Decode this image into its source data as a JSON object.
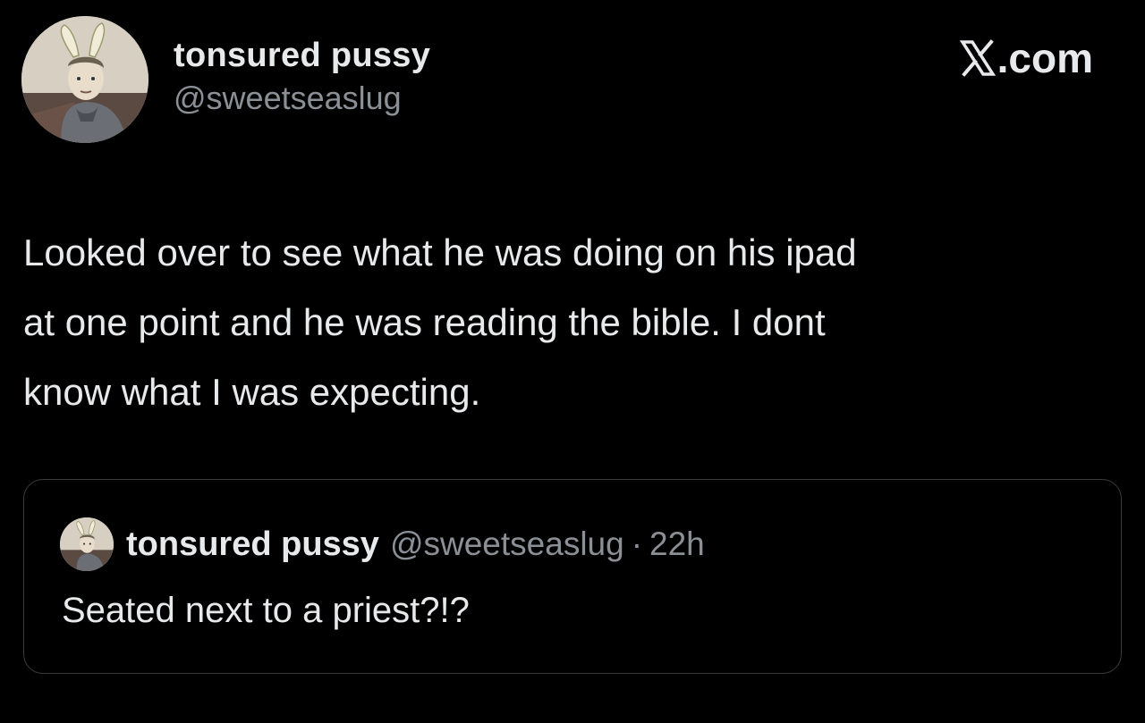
{
  "author": {
    "display_name": "tonsured pussy",
    "handle": "@sweetseaslug",
    "avatar_icon": "monk-bunny-avatar-icon"
  },
  "brand": {
    "label": ".com",
    "logo_icon": "x-logo-icon"
  },
  "tweet": {
    "text": "Looked over to see what he was doing on his ipad\nat one point and he was reading the bible. I dont\nknow what I was expecting."
  },
  "quote": {
    "display_name": "tonsured pussy",
    "handle": "@sweetseaslug",
    "separator": "·",
    "time": "22h",
    "text": "Seated next to a priest?!?"
  },
  "colors": {
    "background": "#000000",
    "primary_text": "#e7e9ea",
    "secondary_text": "#8b9096",
    "border": "#3a3c40"
  }
}
